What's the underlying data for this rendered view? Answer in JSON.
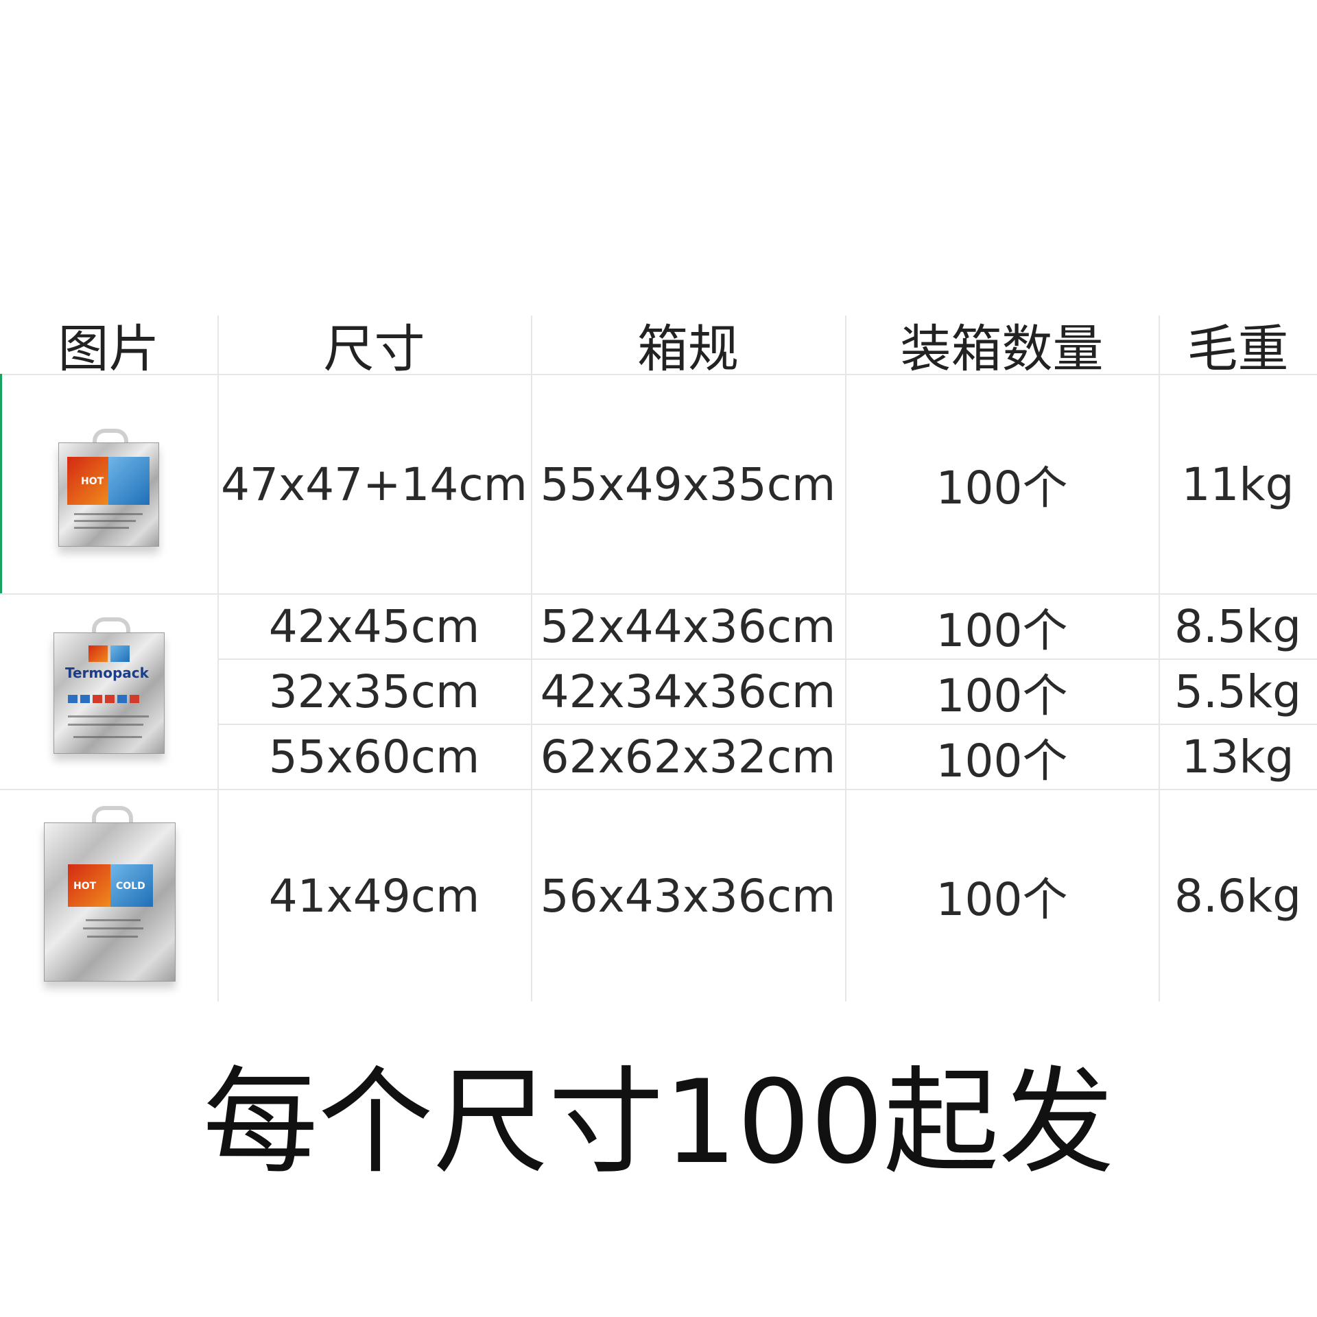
{
  "table": {
    "headers": {
      "image": "图片",
      "size": "尺寸",
      "carton": "箱规",
      "quantity": "装箱数量",
      "weight": "毛重"
    },
    "rows": [
      {
        "size": "47x47+14cm",
        "carton": "55x49x35cm",
        "quantity": "100个",
        "weight": "11kg"
      },
      {
        "size": "42x45cm",
        "carton": "52x44x36cm",
        "quantity": "100个",
        "weight": "8.5kg"
      },
      {
        "size": "32x35cm",
        "carton": "42x34x36cm",
        "quantity": "100个",
        "weight": "5.5kg"
      },
      {
        "size": "55x60cm",
        "carton": "62x62x32cm",
        "quantity": "100个",
        "weight": "13kg"
      },
      {
        "size": "41x49cm",
        "carton": "56x43x36cm",
        "quantity": "100个",
        "weight": "8.6kg"
      }
    ],
    "images": [
      {
        "icon": "hot-cold-foil-bag-image",
        "label": "HOT"
      },
      {
        "icon": "termopack-foil-bag-image",
        "brand": "Termopack"
      },
      {
        "icon": "hot-cold-foil-bag-large-image",
        "labels": [
          "HOT",
          "COLD"
        ]
      }
    ]
  },
  "footer": {
    "text": "每个尺寸100起发"
  }
}
